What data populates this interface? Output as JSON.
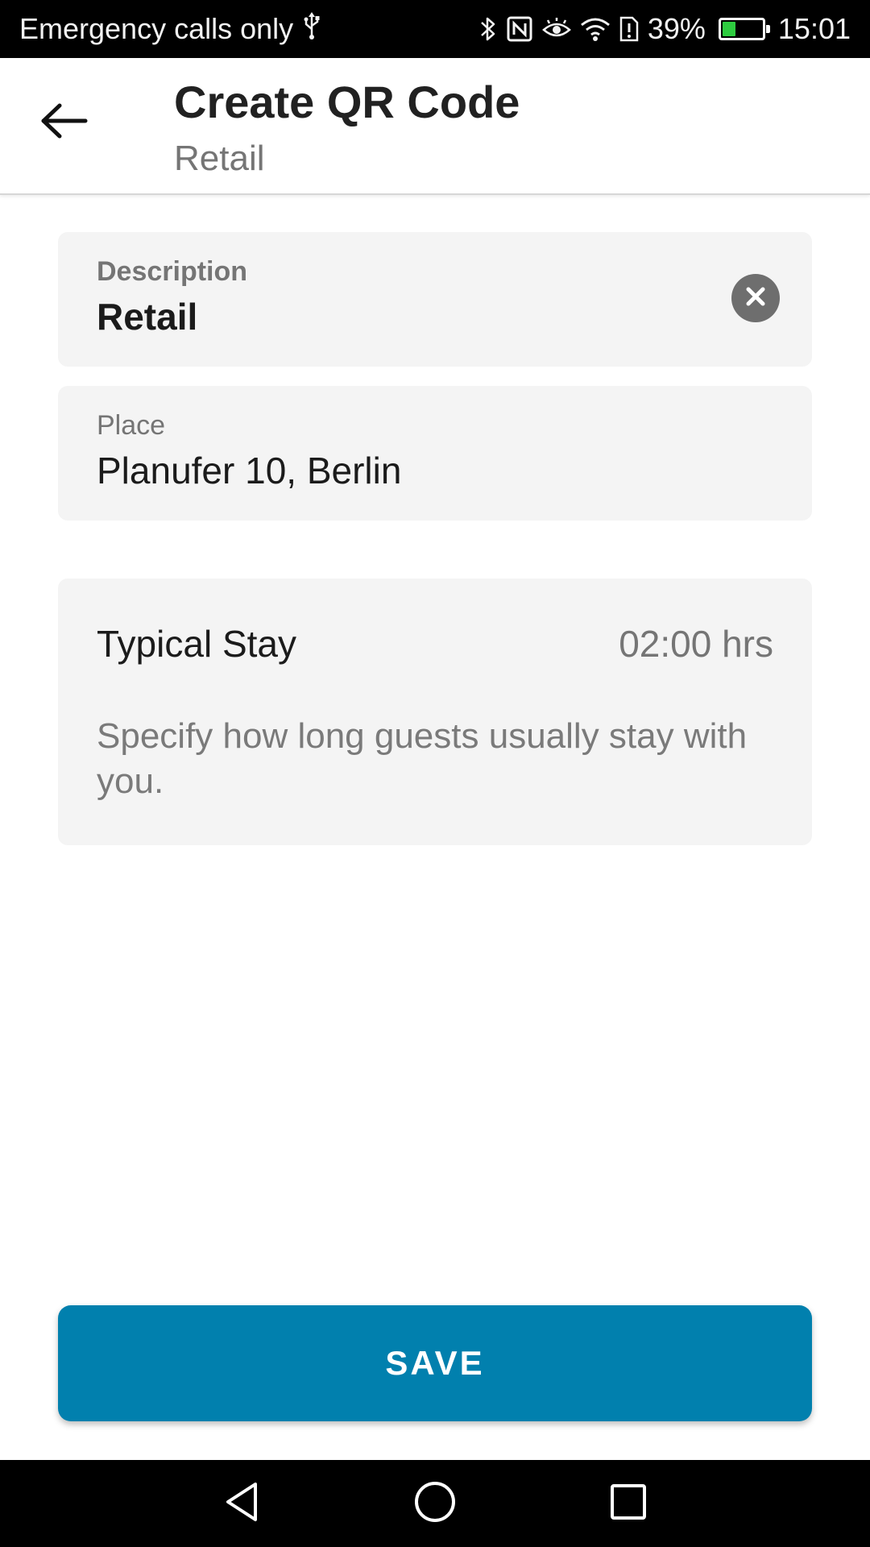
{
  "status_bar": {
    "carrier_text": "Emergency calls only",
    "battery_percent": "39%",
    "battery_level": 0.39,
    "time": "15:01",
    "icons": [
      "usb-icon",
      "bluetooth-icon",
      "nfc-icon",
      "eye-comfort-icon",
      "wifi-icon",
      "sim-alert-icon",
      "battery-icon"
    ],
    "battery_color": "#2ecc40"
  },
  "app_bar": {
    "title": "Create QR Code",
    "subtitle": "Retail",
    "back_icon": "arrow-left-icon"
  },
  "form": {
    "description": {
      "label": "Description",
      "value": "Retail",
      "clear_icon": "clear-circle-icon"
    },
    "place": {
      "label": "Place",
      "value": "Planufer 10, Berlin"
    },
    "typical_stay": {
      "label": "Typical Stay",
      "value": "02:00 hrs",
      "hint": "Specify how long guests usually stay with you."
    }
  },
  "actions": {
    "save_label": "SAVE",
    "accent_color": "#0180ae"
  },
  "nav_bar": {
    "icons": [
      "nav-back-icon",
      "nav-home-icon",
      "nav-recents-icon"
    ]
  }
}
